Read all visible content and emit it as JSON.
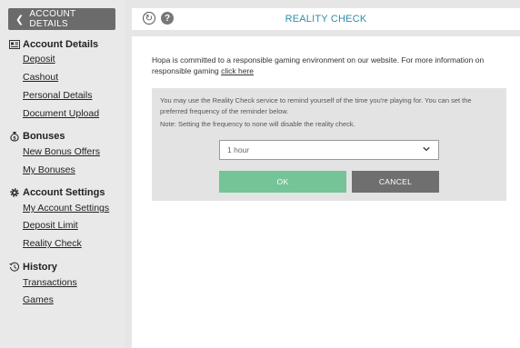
{
  "sidebar": {
    "back_label": "ACCOUNT DETAILS",
    "sections": [
      {
        "title": "Account Details",
        "icon": "id-card-icon",
        "items": [
          "Deposit",
          "Cashout",
          "Personal Details",
          "Document Upload"
        ]
      },
      {
        "title": "Bonuses",
        "icon": "money-bag-icon",
        "items": [
          "New Bonus Offers",
          "My Bonuses"
        ]
      },
      {
        "title": "Account Settings",
        "icon": "gear-icon",
        "items": [
          "My Account Settings",
          "Deposit Limit",
          "Reality Check"
        ]
      },
      {
        "title": "History",
        "icon": "history-clock-icon",
        "items": [
          "Transactions",
          "Games"
        ]
      }
    ]
  },
  "header": {
    "title": "REALITY CHECK",
    "icons": [
      "refresh-icon",
      "help-icon"
    ]
  },
  "main": {
    "intro_text": "Hopa is committed to a responsible gaming environment on our website. For more information on responsible gaming",
    "intro_link": "click here",
    "panel_description": "You may use the Reality Check service to remind yourself of the time you're playing for. You can set the preferred frequency of the reminder below.",
    "panel_note": "Note: Setting the frequency to none will disable the reality check.",
    "frequency_value": "1 hour",
    "ok_label": "OK",
    "cancel_label": "CANCEL"
  },
  "colors": {
    "accent_title": "#2f8ea8",
    "ok_button": "#74c497",
    "cancel_button": "#6f6f6f",
    "back_button": "#6b6b6b"
  }
}
